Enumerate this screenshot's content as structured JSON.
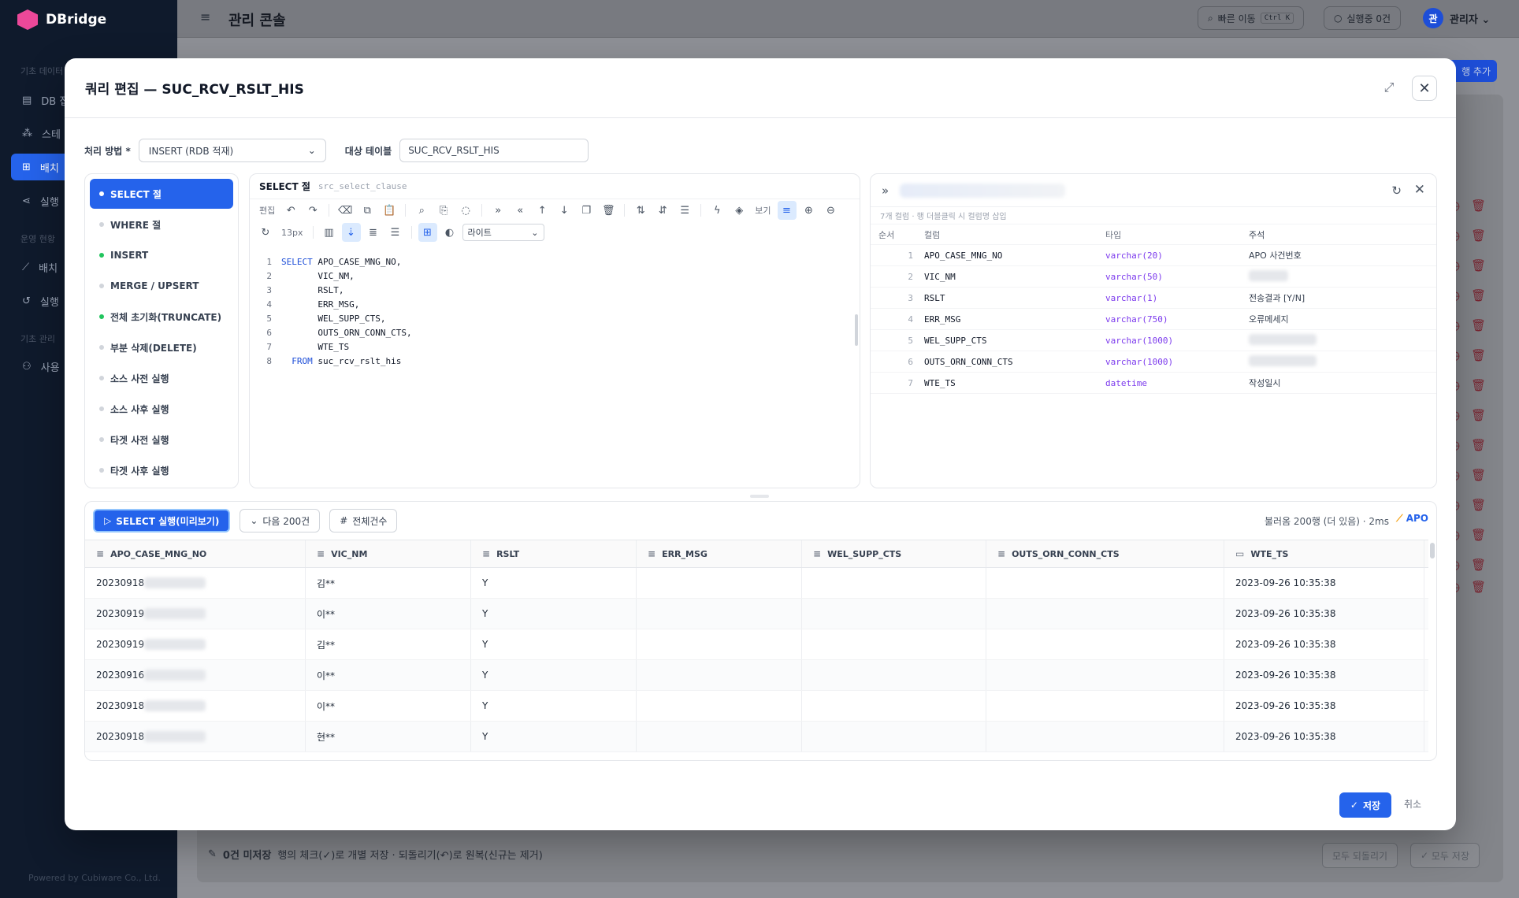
{
  "bg": {
    "brand": "DBridge",
    "header_title": "관리 콘솔",
    "quick_jump": "빠른 이동",
    "quick_jump_kbd": "Ctrl K",
    "running": "실행중 0건",
    "avatar_initial": "관",
    "user": "관리자",
    "add_row": "행 추가",
    "powered_by": "Powered by Cubiware Co., Ltd.",
    "unsaved": "0건 미저장",
    "unsaved_hint": "행의 체크(✓)로 개별 저장 · 되돌리기(↶)로 원복(신규는 제거)",
    "revert_all": "모두 되돌리기",
    "save_all": "모두 저장",
    "sidebar_sections": [
      "기초 데이터",
      "운영 현황",
      "기초 관리"
    ],
    "sidebar_items": [
      "DB 접",
      "스테",
      "배치",
      "실행",
      "배치",
      "실행",
      "사용"
    ]
  },
  "modal": {
    "title": "쿼리 편집 — SUC_RCV_RSLT_HIS",
    "method_label": "처리 방법 *",
    "method_value": "INSERT (RDB 적재)",
    "target_label": "대상 테이블",
    "target_value": "SUC_RCV_RSLT_HIS",
    "clauses": [
      {
        "label": "SELECT 절",
        "state": "active"
      },
      {
        "label": "WHERE 절",
        "state": "empty"
      },
      {
        "label": "INSERT",
        "state": "filled"
      },
      {
        "label": "MERGE / UPSERT",
        "state": "empty"
      },
      {
        "label": "전체 초기화(TRUNCATE)",
        "state": "filled"
      },
      {
        "label": "부분 삭제(DELETE)",
        "state": "empty"
      },
      {
        "label": "소스 사전 실행",
        "state": "empty"
      },
      {
        "label": "소스 사후 실행",
        "state": "empty"
      },
      {
        "label": "타겟 사전 실행",
        "state": "empty"
      },
      {
        "label": "타겟 사후 실행",
        "state": "empty"
      }
    ],
    "editor": {
      "title": "SELECT 절",
      "subtitle": "src_select_clause",
      "edit_label": "편집",
      "view_label": "보기",
      "font_size": "13px",
      "theme": "라이트",
      "lines": [
        {
          "n": "1",
          "kw": "SELECT",
          "text": " APO_CASE_MNG_NO,"
        },
        {
          "n": "2",
          "kw": "",
          "text": "       VIC_NM,"
        },
        {
          "n": "3",
          "kw": "",
          "text": "       RSLT,"
        },
        {
          "n": "4",
          "kw": "",
          "text": "       ERR_MSG,"
        },
        {
          "n": "5",
          "kw": "",
          "text": "       WEL_SUPP_CTS,"
        },
        {
          "n": "6",
          "kw": "",
          "text": "       OUTS_ORN_CONN_CTS,"
        },
        {
          "n": "7",
          "kw": "",
          "text": "       WTE_TS"
        },
        {
          "n": "8",
          "kw": "  FROM",
          "text": " suc_rcv_rslt_his"
        }
      ]
    },
    "columns": {
      "hint": "7개 컬럼 · 행 더블클릭 시 컬럼명 삽입",
      "headers": [
        "순서",
        "컬럼",
        "타입",
        "주석"
      ],
      "rows": [
        {
          "no": "1",
          "name": "APO_CASE_MNG_NO",
          "type": "varchar(20)",
          "comment": "APO 사건번호"
        },
        {
          "no": "2",
          "name": "VIC_NM",
          "type": "varchar(50)",
          "comment": ""
        },
        {
          "no": "3",
          "name": "RSLT",
          "type": "varchar(1)",
          "comment": "전송결과 [Y/N]"
        },
        {
          "no": "4",
          "name": "ERR_MSG",
          "type": "varchar(750)",
          "comment": "오류메세지"
        },
        {
          "no": "5",
          "name": "WEL_SUPP_CTS",
          "type": "varchar(1000)",
          "comment": ""
        },
        {
          "no": "6",
          "name": "OUTS_ORN_CONN_CTS",
          "type": "varchar(1000)",
          "comment": ""
        },
        {
          "no": "7",
          "name": "WTE_TS",
          "type": "datetime",
          "comment": "작성일시"
        }
      ]
    },
    "results": {
      "run_label": "SELECT 실행(미리보기)",
      "next_label": "다음 200건",
      "count_label": "전체건수",
      "status": "불러옴 200행 (더 있음) · 2ms",
      "source": "APO",
      "headers": [
        "APO_CASE_MNG_NO",
        "VIC_NM",
        "RSLT",
        "ERR_MSG",
        "WEL_SUPP_CTS",
        "OUTS_ORN_CONN_CTS",
        "WTE_TS"
      ],
      "rows": [
        [
          "20230918",
          "김**",
          "Y",
          "",
          "",
          "",
          "2023-09-26 10:35:38"
        ],
        [
          "20230919",
          "이**",
          "Y",
          "",
          "",
          "",
          "2023-09-26 10:35:38"
        ],
        [
          "20230919",
          "김**",
          "Y",
          "",
          "",
          "",
          "2023-09-26 10:35:38"
        ],
        [
          "20230916",
          "이**",
          "Y",
          "",
          "",
          "",
          "2023-09-26 10:35:38"
        ],
        [
          "20230918",
          "이**",
          "Y",
          "",
          "",
          "",
          "2023-09-26 10:35:38"
        ],
        [
          "20230918",
          "현**",
          "Y",
          "",
          "",
          "",
          "2023-09-26 10:35:38"
        ]
      ]
    },
    "save_label": "저장",
    "cancel_label": "취소"
  }
}
